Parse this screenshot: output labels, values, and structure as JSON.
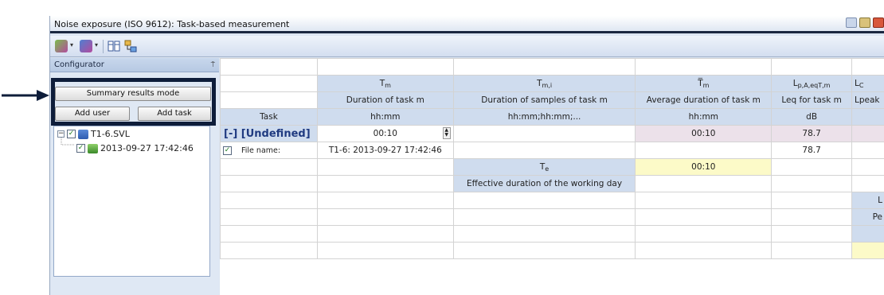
{
  "window": {
    "title": "Noise exposure (ISO 9612): Task-based measurement"
  },
  "toolbar": {
    "icons": [
      "config-icon",
      "report-icon",
      "columns-icon",
      "tree-icon"
    ]
  },
  "configurator": {
    "title": "Configurator",
    "pin": "⍑",
    "summary_button": "Summary results mode",
    "add_user_button": "Add user",
    "add_task_button": "Add task",
    "tree": [
      {
        "label": "T1-6.SVL"
      },
      {
        "label": "2013-09-27 17:42:46"
      }
    ]
  },
  "grid": {
    "headers": {
      "tm_symbol": "T",
      "tm_sub": "m",
      "tmi_symbol": "T",
      "tmi_sub": "m,i",
      "tmbar_symbol": "T̅",
      "tmbar_sub": "m",
      "lp_symbol": "L",
      "lp_sub": "p,A,eqT,m",
      "lc_symbol": "L",
      "lc_sub": "C"
    },
    "descriptions": {
      "tm": "Duration of task m",
      "tmi": "Duration of samples of task m",
      "tmbar": "Average duration of task m",
      "lp": "Leq for task m",
      "lc": "Lpeak"
    },
    "units": {
      "task": "Task",
      "tm": "hh:mm",
      "tmi": "hh:mm;hh:mm;...",
      "tmbar": "hh:mm",
      "lp": "dB"
    },
    "task_row": {
      "label": "[-] [Undefined]",
      "tm": "00:10",
      "tmbar": "00:10",
      "lp": "78.7"
    },
    "file_row": {
      "checkbox": "✓",
      "label": "File name:",
      "value": "T1-6: 2013-09-27 17:42:46",
      "lp": "78.7"
    },
    "effective": {
      "symbol": "T",
      "sub": "e",
      "value": "00:10",
      "description": "Effective duration of the working day"
    },
    "partial": {
      "l": "L",
      "pe": "Pe"
    }
  }
}
